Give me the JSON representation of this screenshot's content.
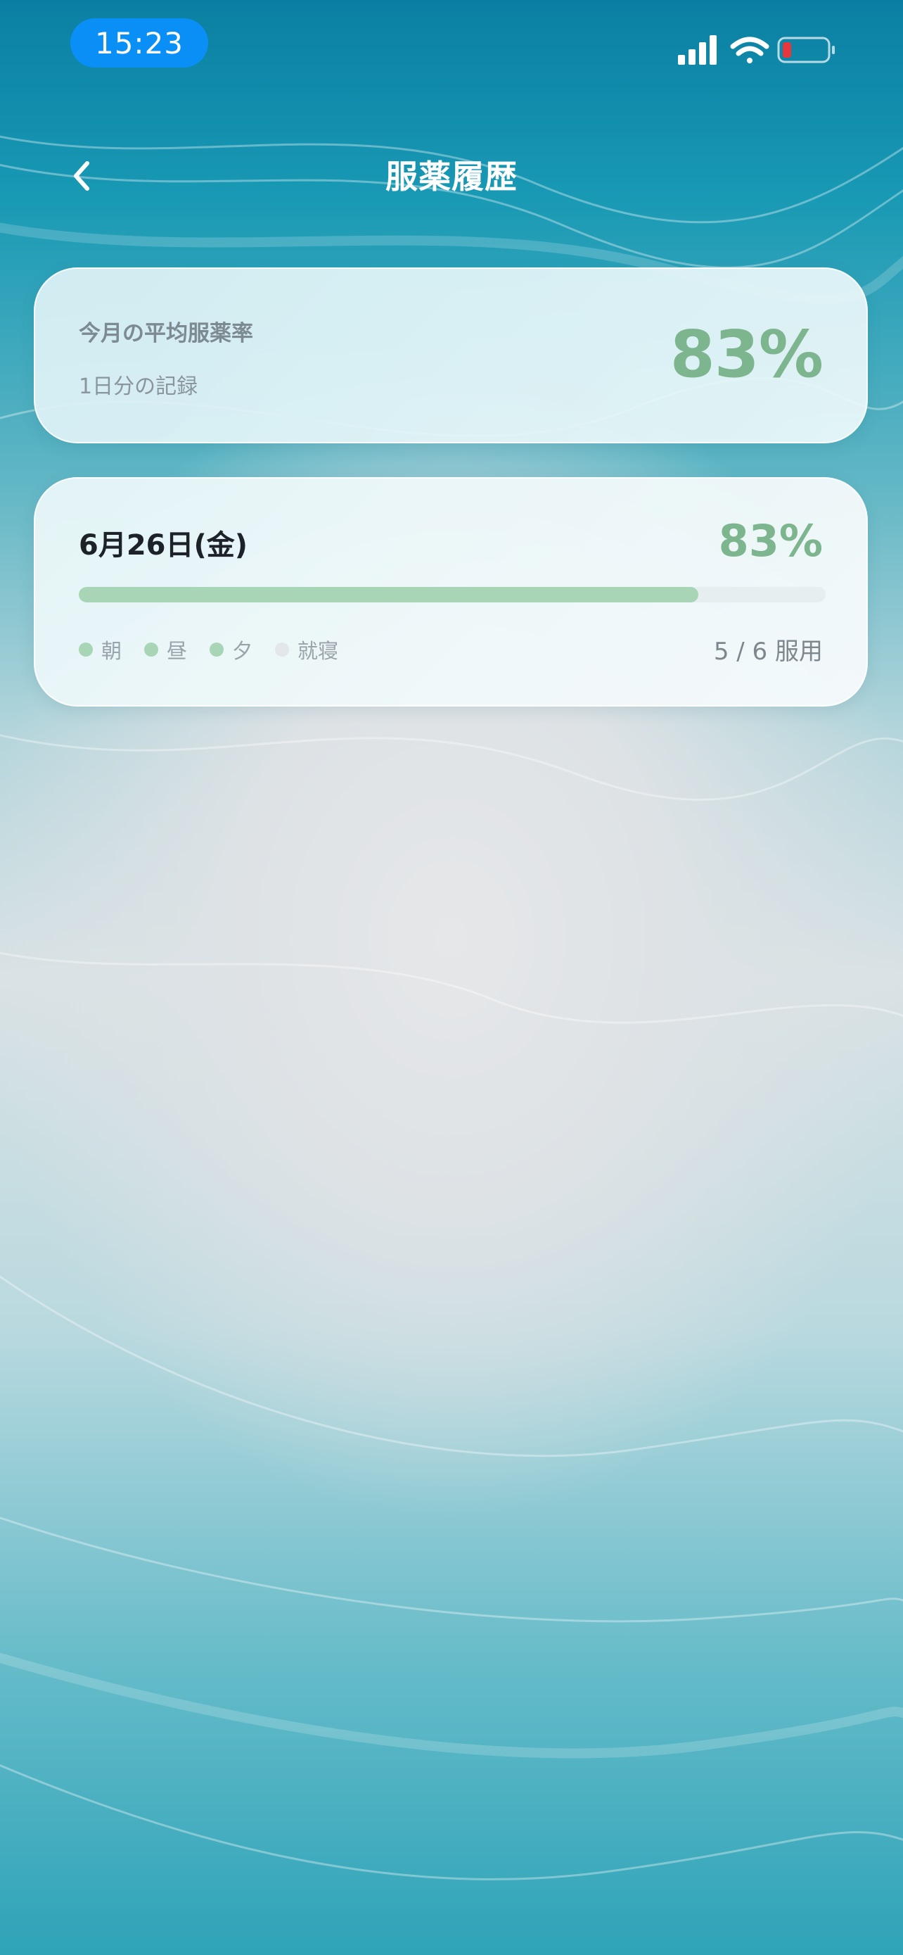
{
  "status_bar": {
    "time": "15:23",
    "icons": [
      "cellular-signal-icon",
      "wifi-icon",
      "battery-low-icon"
    ],
    "pill_color": "#0a8ff7",
    "battery_color": "#e8363d"
  },
  "header": {
    "title": "服薬履歴",
    "back_icon": "chevron-left-icon"
  },
  "summary": {
    "label": "今月の平均服薬率",
    "sub": "1日分の記録",
    "rate": "83%"
  },
  "days": [
    {
      "date": "6月26日(金)",
      "rate": "83%",
      "progress": 0.83,
      "slots": [
        {
          "label": "朝",
          "taken": true
        },
        {
          "label": "昼",
          "taken": true
        },
        {
          "label": "夕",
          "taken": true
        },
        {
          "label": "就寝",
          "taken": false
        }
      ],
      "dose_count": "5 / 6 服用"
    }
  ],
  "colors": {
    "accent_green": "#7db58f",
    "progress_green": "#a8d5b5",
    "header_blue": "#0b7fa3"
  }
}
